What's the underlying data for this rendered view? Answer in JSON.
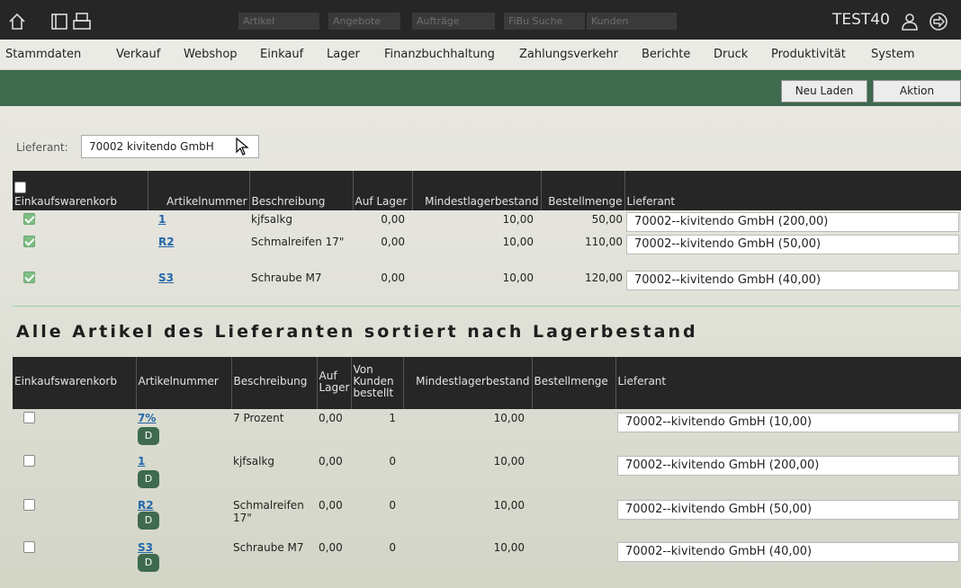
{
  "topbar": {
    "icons": [
      "home-icon",
      "window-icon",
      "printer-icon",
      "user-icon",
      "logout-icon"
    ],
    "search_fields": [
      "Artikel",
      "Angebote",
      "Aufträge",
      "FiBu Suche",
      "Kunden"
    ],
    "client": "TEST40"
  },
  "menu": [
    "Stammdaten",
    "Verkauf",
    "Webshop",
    "Einkauf",
    "Lager",
    "Finanzbuchhaltung",
    "Zahlungsverkehr",
    "Berichte",
    "Druck",
    "Produktivität",
    "System"
  ],
  "actions": {
    "reload": "Neu Laden",
    "action": "Aktion"
  },
  "supplier": {
    "label": "Lieferant:",
    "value": "70002 kivitendo GmbH"
  },
  "table1": {
    "headers": [
      "Einkaufswarenkorb",
      "Artikelnummer",
      "Beschreibung",
      "Auf Lager",
      "Mindestlagerbestand",
      "Bestellmenge",
      "Lieferant"
    ],
    "rows": [
      {
        "checked": true,
        "artnr": "1",
        "desc": "kjfsalkg",
        "stock": "0,00",
        "min": "10,00",
        "qty": "50,00",
        "supplier": "70002--kivitendo GmbH (200,00)"
      },
      {
        "checked": true,
        "artnr": "R2",
        "desc": "Schmalreifen 17\"",
        "stock": "0,00",
        "min": "10,00",
        "qty": "110,00",
        "supplier": "70002--kivitendo GmbH (50,00)"
      },
      {
        "checked": true,
        "artnr": "S3",
        "desc": "Schraube M7",
        "stock": "0,00",
        "min": "10,00",
        "qty": "120,00",
        "supplier": "70002--kivitendo GmbH (40,00)"
      }
    ]
  },
  "section_title": "Alle Artikel des Lieferanten sortiert nach Lagerbestand",
  "table2": {
    "headers": [
      "Einkaufswarenkorb",
      "Artikelnummer",
      "Beschreibung",
      "Auf Lager",
      "Von Kunden bestellt",
      "Mindestlagerbestand",
      "Bestellmenge",
      "Lieferant"
    ],
    "d_label": "D",
    "rows": [
      {
        "checked": false,
        "artnr": "7%",
        "desc": "7 Prozent",
        "stock": "0,00",
        "ordered": "1",
        "min": "10,00",
        "qty": "",
        "supplier": "70002--kivitendo GmbH (10,00)"
      },
      {
        "checked": false,
        "artnr": "1",
        "desc": "kjfsalkg",
        "stock": "0,00",
        "ordered": "0",
        "min": "10,00",
        "qty": "",
        "supplier": "70002--kivitendo GmbH (200,00)"
      },
      {
        "checked": false,
        "artnr": "R2",
        "desc": "Schmalreifen 17\"",
        "stock": "0,00",
        "ordered": "0",
        "min": "10,00",
        "qty": "",
        "supplier": "70002--kivitendo GmbH (50,00)"
      },
      {
        "checked": false,
        "artnr": "S3",
        "desc": "Schraube M7",
        "stock": "0,00",
        "ordered": "0",
        "min": "10,00",
        "qty": "",
        "supplier": "70002--kivitendo GmbH (40,00)"
      }
    ]
  },
  "colors": {
    "topbar": "#262626",
    "actionbar": "#3f6a4e",
    "link": "#2266aa",
    "check": "#7fbe84"
  }
}
